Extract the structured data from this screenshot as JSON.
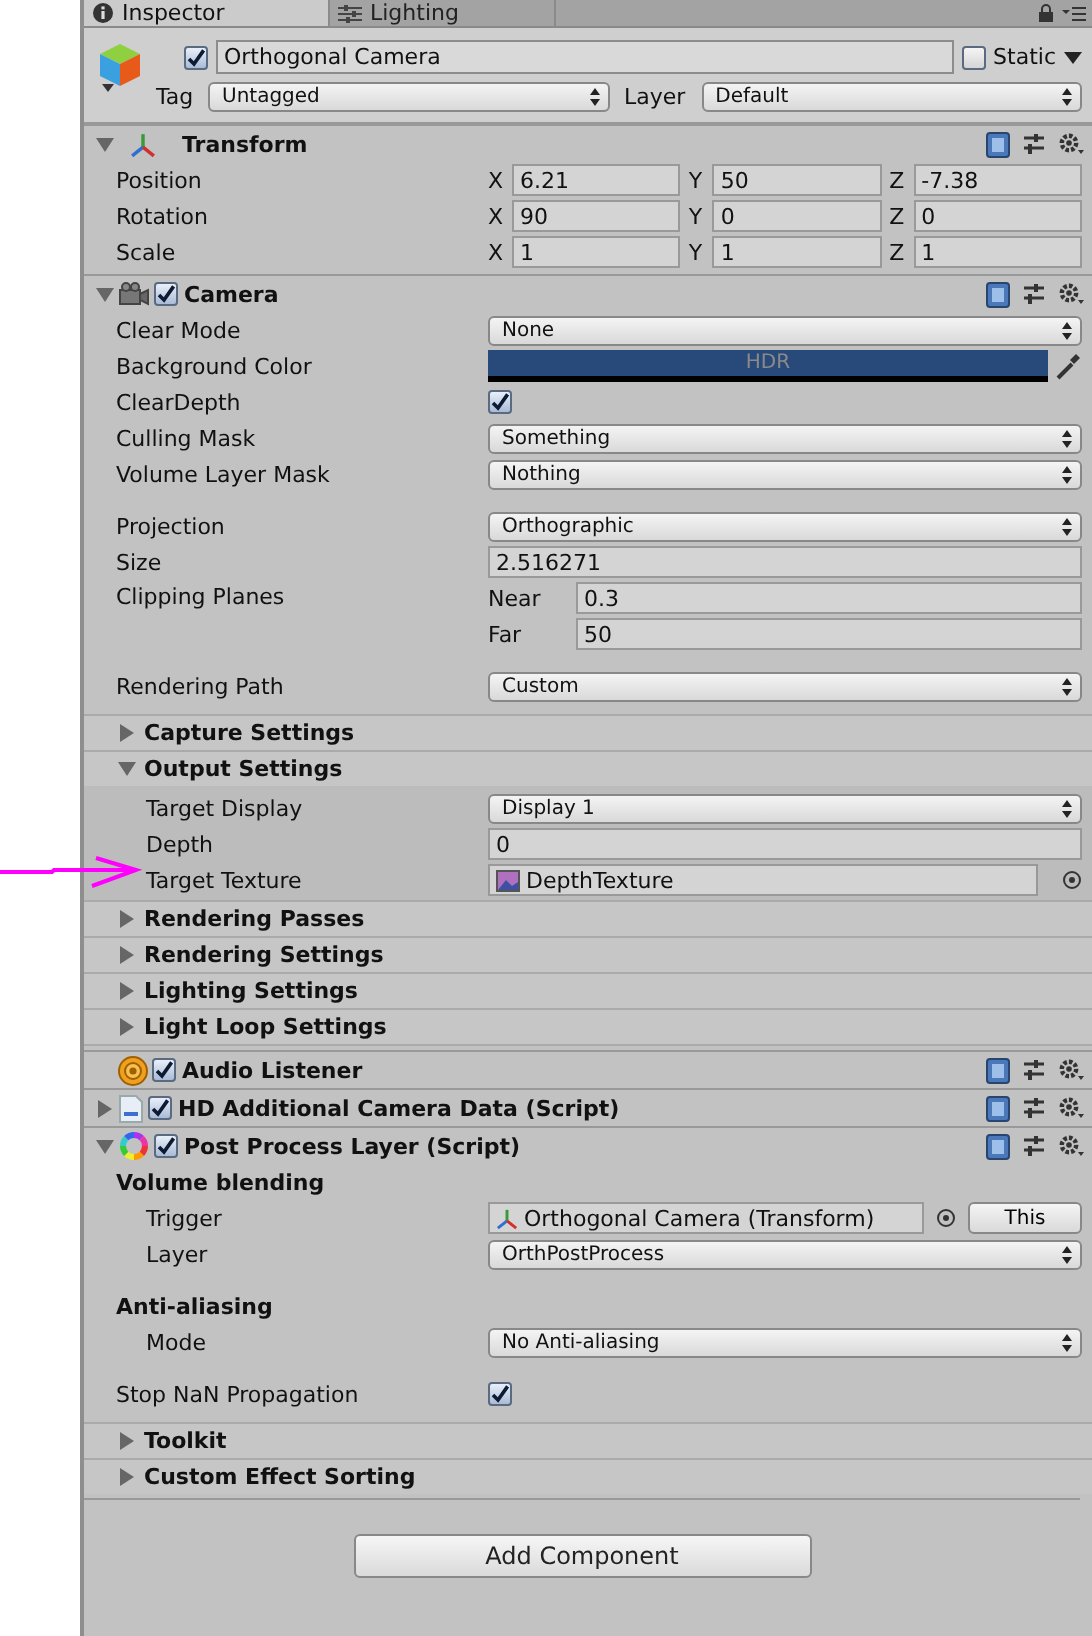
{
  "tabs": [
    {
      "label": "Inspector",
      "selected": true
    },
    {
      "label": "Lighting",
      "selected": false
    }
  ],
  "object": {
    "active": true,
    "name": "Orthogonal Camera",
    "static_label": "Static",
    "static": false,
    "tag_label": "Tag",
    "tag": "Untagged",
    "layer_label": "Layer",
    "layer": "Default"
  },
  "components": [
    {
      "kind": "transform",
      "title": "Transform",
      "expanded": true,
      "groups": [
        [
          {
            "kind": "vector3",
            "label": "Position",
            "axes": [
              {
                "axis": "X",
                "value": "6.21"
              },
              {
                "axis": "Y",
                "value": "50"
              },
              {
                "axis": "Z",
                "value": "-7.38"
              }
            ]
          },
          {
            "kind": "vector3",
            "label": "Rotation",
            "axes": [
              {
                "axis": "X",
                "value": "90"
              },
              {
                "axis": "Y",
                "value": "0"
              },
              {
                "axis": "Z",
                "value": "0"
              }
            ]
          },
          {
            "kind": "vector3",
            "label": "Scale",
            "axes": [
              {
                "axis": "X",
                "value": "1"
              },
              {
                "axis": "Y",
                "value": "1"
              },
              {
                "axis": "Z",
                "value": "1"
              }
            ]
          }
        ]
      ]
    },
    {
      "kind": "camera",
      "title": "Camera",
      "enabled": true,
      "expanded": true,
      "groups": [
        [
          {
            "kind": "dropdown",
            "label": "Clear Mode",
            "value": "None"
          },
          {
            "kind": "color",
            "label": "Background Color",
            "value": "HDR",
            "color": "#284a7a"
          },
          {
            "kind": "checkbox",
            "label": "ClearDepth",
            "checked": true
          },
          {
            "kind": "dropdown",
            "label": "Culling Mask",
            "value": "Something"
          },
          {
            "kind": "dropdown",
            "label": "Volume Layer Mask",
            "value": "Nothing"
          }
        ],
        [
          {
            "kind": "dropdown",
            "label": "Projection",
            "value": "Orthographic"
          },
          {
            "kind": "text",
            "label": "Size",
            "value": "2.516271"
          },
          {
            "kind": "clip",
            "label": "Clipping Planes",
            "near_label": "Near",
            "near": "0.3",
            "far_label": "Far",
            "far": "50"
          }
        ],
        [
          {
            "kind": "dropdown",
            "label": "Rendering Path",
            "value": "Custom"
          }
        ],
        [
          {
            "kind": "foldout",
            "label": "Capture Settings",
            "expanded": false
          },
          {
            "kind": "foldout",
            "label": "Output Settings",
            "expanded": true,
            "children": [
              {
                "kind": "dropdown",
                "label": "Target Display",
                "value": "Display 1"
              },
              {
                "kind": "text",
                "label": "Depth",
                "value": "0"
              },
              {
                "kind": "object",
                "label": "Target Texture",
                "value": "DepthTexture"
              }
            ]
          },
          {
            "kind": "foldout",
            "label": "Rendering Passes",
            "expanded": false
          },
          {
            "kind": "foldout",
            "label": "Rendering Settings",
            "expanded": false
          },
          {
            "kind": "foldout",
            "label": "Lighting Settings",
            "expanded": false
          },
          {
            "kind": "foldout",
            "label": "Light Loop Settings",
            "expanded": false
          }
        ]
      ]
    },
    {
      "kind": "audio",
      "title": "Audio Listener",
      "enabled": true
    },
    {
      "kind": "script",
      "title": "HD Additional Camera Data (Script)",
      "enabled": true,
      "expanded": false
    },
    {
      "kind": "postprocess",
      "title": "Post Process Layer (Script)",
      "enabled": true,
      "expanded": true,
      "groups": [
        [
          {
            "kind": "heading",
            "label": "Volume blending",
            "children": [
              {
                "kind": "reference",
                "label": "Trigger",
                "value": "Orthogonal Camera (Transform)",
                "button": "This"
              },
              {
                "kind": "dropdown",
                "label": "Layer",
                "value": "OrthPostProcess"
              }
            ]
          }
        ],
        [
          {
            "kind": "heading",
            "label": "Anti-aliasing",
            "children": [
              {
                "kind": "dropdown",
                "label": "Mode",
                "value": "No Anti-aliasing"
              }
            ]
          }
        ],
        [
          {
            "kind": "checkbox",
            "label": "Stop NaN Propagation",
            "checked": true
          }
        ],
        [
          {
            "kind": "foldout",
            "label": "Toolkit",
            "expanded": false
          },
          {
            "kind": "foldout",
            "label": "Custom Effect Sorting",
            "expanded": false
          }
        ]
      ]
    }
  ],
  "add_button": "Add Component"
}
